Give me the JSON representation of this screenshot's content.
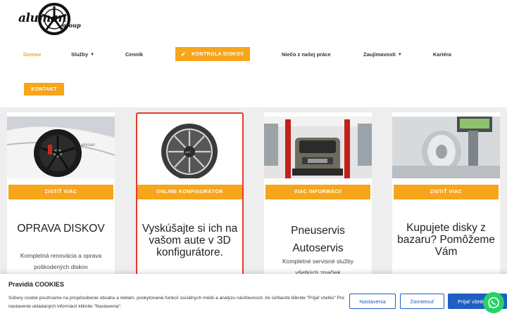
{
  "brand": {
    "name": "aluman",
    "sub": "group"
  },
  "nav": {
    "home": "Domov",
    "services": "Služby",
    "pricing": "Cenník",
    "cta": "KONTROLA DISKOV",
    "work": "Niečo z našej práce",
    "interesting": "Zaujímavosti",
    "career": "Kariéra",
    "contact": "KONTAKT"
  },
  "cards": [
    {
      "button": "ZISTIŤ VIAC",
      "title": "OPRAVA DISKOV",
      "text": "Kompletná renovácia a oprava poškodených diskov"
    },
    {
      "button": "ONLINE KONFIGURÁTOR",
      "title": "Vyskúšajte si ich na vašom aute v 3D konfigurátore."
    },
    {
      "button": "VIAC INFORMÁCIÍ",
      "title": "Pneuservis Autoservis",
      "text": "Kompletné servisné služby všetkých značiek"
    },
    {
      "button": "ZISTIŤ VIAC",
      "title": "Kupujete disky z bazaru? Pomôžeme Vám"
    }
  ],
  "cookie": {
    "title": "Pravidlá COOKIES",
    "text": "Súbory cookie používame na prispôsobenie obsahu a reklám, poskytovanie funkcií sociálnych médií a analýzu návštevnosti. Ak súhlasíte kliknite \"Prijať všetko\" Pre nastavenie ukladaných informácií kliknite \"Nastavenia\".",
    "settings": "Nastavenia",
    "reject": "Zamietnuť",
    "accept": "Prijať všetko"
  },
  "colors": {
    "accent": "#f7a51b",
    "highlight": "#e53b2c",
    "cookie_button": "#1f5fc1",
    "whatsapp": "#25d366"
  },
  "icons": {
    "cta": "check-badge-icon",
    "whatsapp": "whatsapp-icon"
  }
}
